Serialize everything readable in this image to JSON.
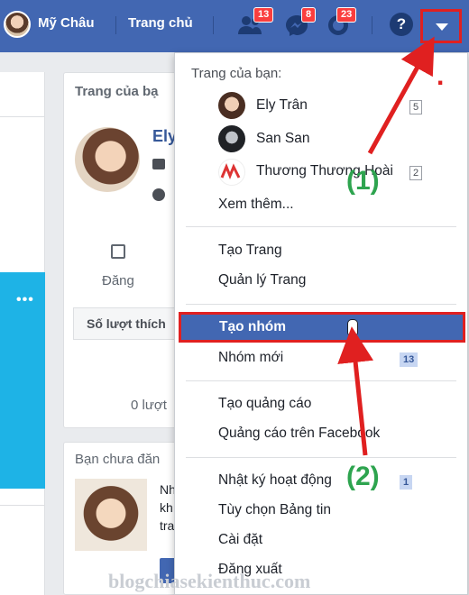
{
  "topbar": {
    "user_name": "Mỹ Châu",
    "home_label": "Trang chủ",
    "badges": {
      "friend_requests": "13",
      "messages": "8",
      "notifications": "23"
    },
    "help_label": "?",
    "icons": [
      "friend-requests-icon",
      "messenger-icon",
      "notifications-icon",
      "help-icon",
      "dropdown-arrow-icon"
    ]
  },
  "background": {
    "pages_card_title": "Trang của bạ",
    "page_name": "Ely",
    "post_label": "Đăng",
    "likes_label": "Số lượt thích",
    "zero_views": "0 lượt",
    "friends_title": "Bạn chưa đăn",
    "friend_snippet": [
      "Nh",
      "kh",
      "tra"
    ]
  },
  "menu": {
    "header": "Trang của bạn:",
    "pages": [
      {
        "name": "Ely Trân",
        "count": "5"
      },
      {
        "name": "San San",
        "count": ""
      },
      {
        "name": "Thương Thương Hoài",
        "count": "2"
      }
    ],
    "see_more": "Xem thêm...",
    "create_page": "Tạo Trang",
    "manage_pages": "Quản lý Trang",
    "create_group": "Tạo nhóm",
    "new_groups": "Nhóm mới",
    "new_groups_count": "13",
    "create_ad": "Tạo quảng cáo",
    "ads_on_facebook": "Quảng cáo trên Facebook",
    "activity_log": "Nhật ký hoạt động",
    "activity_log_count": "1",
    "news_feed_prefs": "Tùy chọn Bảng tin",
    "settings": "Cài đặt",
    "logout": "Đăng xuất"
  },
  "annotations": {
    "step1": "(1)",
    "step2": "(2)",
    "dot": "."
  },
  "watermark": "blogchiasekienthuc.com",
  "colors": {
    "brand_blue": "#4267b2",
    "highlight_red": "#e02020",
    "annotation_green": "#2ea44f",
    "badge_red": "#fa3e3e"
  }
}
